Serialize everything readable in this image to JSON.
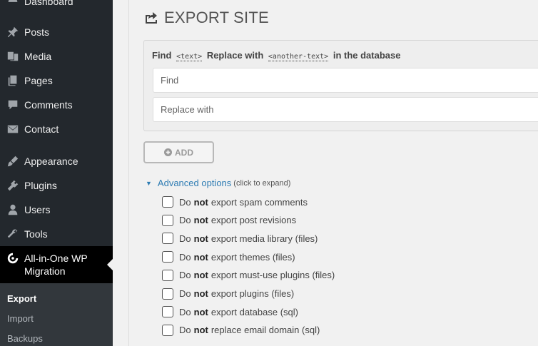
{
  "sidebar": {
    "dashboard_label": "Dashboard",
    "items": [
      {
        "label": "Posts",
        "icon": "pin-icon"
      },
      {
        "label": "Media",
        "icon": "media-icon"
      },
      {
        "label": "Pages",
        "icon": "pages-icon"
      },
      {
        "label": "Comments",
        "icon": "comment-icon"
      },
      {
        "label": "Contact",
        "icon": "mail-icon"
      },
      {
        "label": "Appearance",
        "icon": "brush-icon"
      },
      {
        "label": "Plugins",
        "icon": "plugin-icon"
      },
      {
        "label": "Users",
        "icon": "user-icon"
      },
      {
        "label": "Tools",
        "icon": "wrench-icon"
      }
    ],
    "active": {
      "label_line1": "All-in-One WP",
      "label_line2": "Migration",
      "icon": "migration-icon"
    },
    "submenu": [
      "Export",
      "Import",
      "Backups"
    ]
  },
  "page": {
    "title": "EXPORT SITE",
    "title_icon": "export-icon"
  },
  "find_replace": {
    "find_word": "Find",
    "text_token": "<text>",
    "replace_word": "Replace with",
    "another_token": "<another-text>",
    "suffix": "in the database",
    "find_placeholder": "Find",
    "replace_placeholder": "Replace with"
  },
  "add_button": {
    "label": "ADD",
    "icon": "plus-circle-icon"
  },
  "advanced": {
    "label": "Advanced options",
    "hint": "(click to expand)"
  },
  "options": [
    {
      "prefix": "Do",
      "emph": "not",
      "rest": "export spam comments"
    },
    {
      "prefix": "Do",
      "emph": "not",
      "rest": "export post revisions"
    },
    {
      "prefix": "Do",
      "emph": "not",
      "rest": "export media library (files)"
    },
    {
      "prefix": "Do",
      "emph": "not",
      "rest": "export themes (files)"
    },
    {
      "prefix": "Do",
      "emph": "not",
      "rest": "export must-use plugins (files)"
    },
    {
      "prefix": "Do",
      "emph": "not",
      "rest": "export plugins (files)"
    },
    {
      "prefix": "Do",
      "emph": "not",
      "rest": "export database (sql)"
    },
    {
      "prefix": "Do",
      "emph": "not",
      "rest": "replace email domain (sql)"
    }
  ],
  "colors": {
    "sidebar_bg": "#23282d",
    "submenu_bg": "#32373c",
    "link": "#2e7cb3"
  }
}
